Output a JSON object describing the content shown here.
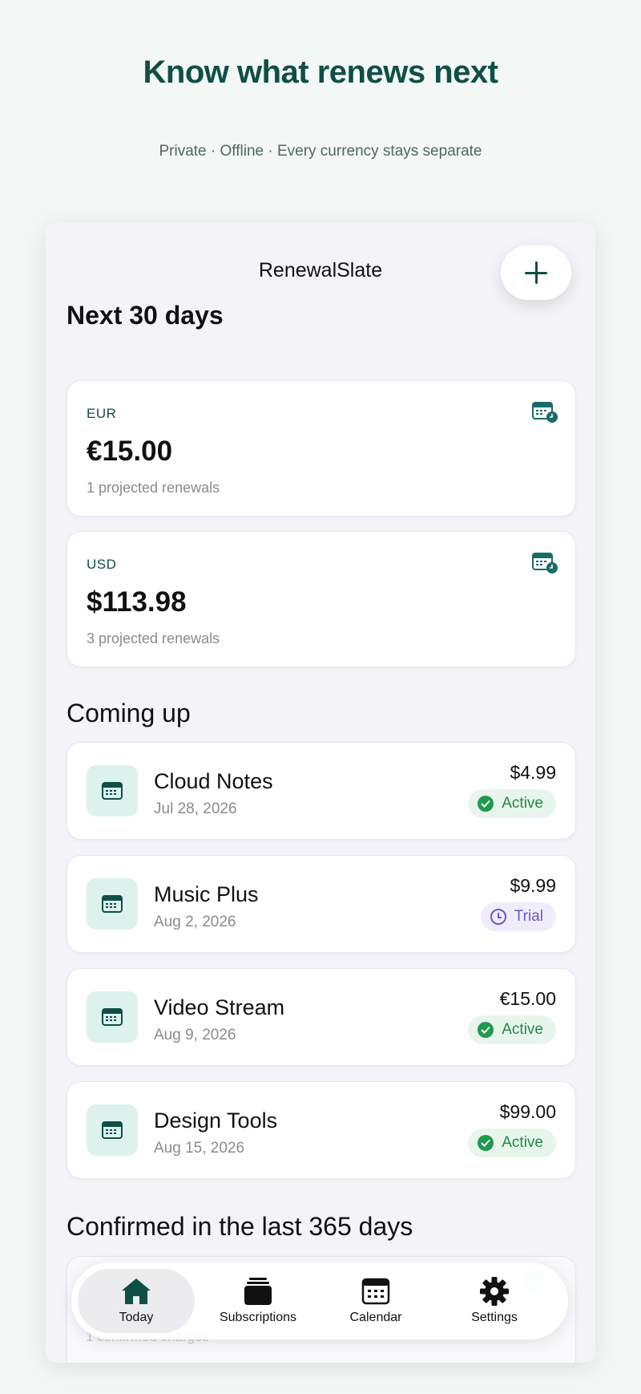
{
  "hero": {
    "title": "Know what renews next",
    "subtitle": "Private · Offline · Every currency stays separate"
  },
  "app": {
    "title": "RenewalSlate",
    "add_icon": "plus-icon"
  },
  "next30": {
    "heading": "Next 30 days",
    "cards": [
      {
        "currency": "EUR",
        "amount": "€15.00",
        "count_text": "1 projected renewals",
        "icon": "calendar-clock-icon"
      },
      {
        "currency": "USD",
        "amount": "$113.98",
        "count_text": "3 projected renewals",
        "icon": "calendar-clock-icon"
      }
    ]
  },
  "coming_up": {
    "heading": "Coming up",
    "items": [
      {
        "name": "Cloud Notes",
        "date": "Jul 28, 2026",
        "price": "$4.99",
        "status": "Active",
        "status_type": "active"
      },
      {
        "name": "Music Plus",
        "date": "Aug 2, 2026",
        "price": "$9.99",
        "status": "Trial",
        "status_type": "trial"
      },
      {
        "name": "Video Stream",
        "date": "Aug 9, 2026",
        "price": "€15.00",
        "status": "Active",
        "status_type": "active"
      },
      {
        "name": "Design Tools",
        "date": "Aug 15, 2026",
        "price": "$99.00",
        "status": "Active",
        "status_type": "active"
      }
    ]
  },
  "confirmed": {
    "heading": "Confirmed in the last 365 days",
    "partial_count": "1 confirmed charges"
  },
  "tabs": [
    {
      "label": "Today",
      "icon": "house-icon",
      "selected": true
    },
    {
      "label": "Subscriptions",
      "icon": "stack-icon",
      "selected": false
    },
    {
      "label": "Calendar",
      "icon": "calendar-icon",
      "selected": false
    },
    {
      "label": "Settings",
      "icon": "gear-icon",
      "selected": false
    }
  ],
  "colors": {
    "brand": "#0f4f45",
    "active": "#1f8a45",
    "trial": "#7058c8",
    "icon_bg": "#ddf2ec"
  }
}
